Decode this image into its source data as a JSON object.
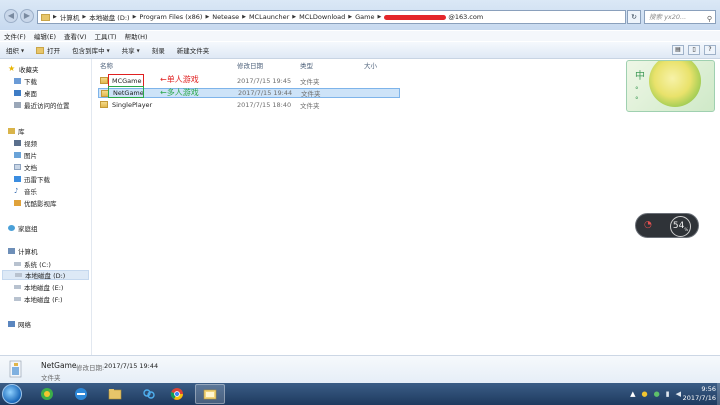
{
  "address": {
    "crumbs": [
      "计算机",
      "本地磁盘 (D:)",
      "Program Files (x86)",
      "Netease",
      "MCLauncher",
      "MCLDownload",
      "Game"
    ],
    "email_suffix": "@163.com",
    "search_placeholder": "搜索 yx20..."
  },
  "menu": [
    "文件(F)",
    "编辑(E)",
    "查看(V)",
    "工具(T)",
    "帮助(H)"
  ],
  "toolbar": {
    "organize": "组织",
    "open": "打开",
    "include_library": "包含到库中",
    "share": "共享",
    "burn": "刻录",
    "new_folder": "新建文件夹"
  },
  "sidebar": {
    "favorites": "收藏夹",
    "favorites_items": [
      "下载",
      "桌面",
      "最近访问的位置"
    ],
    "libraries": "库",
    "library_items": [
      "视频",
      "图片",
      "文档",
      "迅雷下载",
      "音乐",
      "优酷影视库"
    ],
    "homegroup": "家庭组",
    "computer": "计算机",
    "computer_items": [
      "系统 (C:)",
      "本地磁盘 (D:)",
      "本地磁盘 (E:)",
      "本地磁盘 (F:)"
    ],
    "network": "网络"
  },
  "columns": {
    "name": "名称",
    "modified": "修改日期",
    "type": "类型",
    "size": "大小"
  },
  "files": [
    {
      "name": "MCGame",
      "modified": "2017/7/15 19:45",
      "type": "文件夹",
      "annotation": "←单人游戏"
    },
    {
      "name": "NetGame",
      "modified": "2017/7/15 19:44",
      "type": "文件夹",
      "annotation": "←多人游戏"
    },
    {
      "name": "SinglePlayer",
      "modified": "2017/7/15 18:40",
      "type": "文件夹",
      "annotation": ""
    }
  ],
  "widget": {
    "char": "中",
    "dots": "°\n°",
    "net_percent": "54",
    "net_unit": "%"
  },
  "details": {
    "name": "NetGame",
    "modified_label": "修改日期:",
    "modified_value": "2017/7/15 19:44",
    "type": "文件夹"
  },
  "clock": {
    "time": "9:56",
    "date": "2017/7/16"
  },
  "colors": {
    "annotation_red": "#e02020",
    "annotation_green": "#2aa84a",
    "selection": "#cde3f8",
    "taskbar": "#1e3a5f"
  }
}
